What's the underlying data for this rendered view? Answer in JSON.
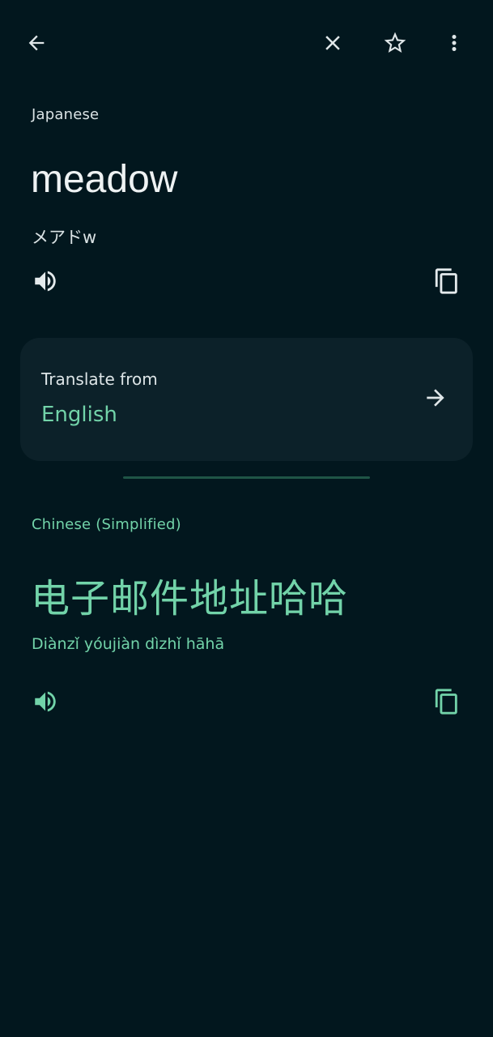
{
  "toolbar": {
    "back_icon": "arrow-back-icon",
    "close_icon": "close-icon",
    "star_icon": "star-outline-icon",
    "more_icon": "more-vert-icon"
  },
  "source": {
    "language": "Japanese",
    "text": "meadow",
    "transliteration": "メアドw",
    "speak_icon": "volume-up-icon",
    "copy_icon": "copy-icon"
  },
  "translate_from_card": {
    "label": "Translate from",
    "language": "English",
    "arrow_icon": "arrow-forward-icon"
  },
  "target": {
    "language": "Chinese (Simplified)",
    "text": "电子邮件地址哈哈",
    "transliteration": "Diànzǐ yóujiàn dìzhǐ hāhā",
    "speak_icon": "volume-up-icon",
    "copy_icon": "copy-icon"
  },
  "colors": {
    "background": "#02171e",
    "card": "#0c2129",
    "accent": "#72d3a9",
    "text": "#e6ecee"
  }
}
